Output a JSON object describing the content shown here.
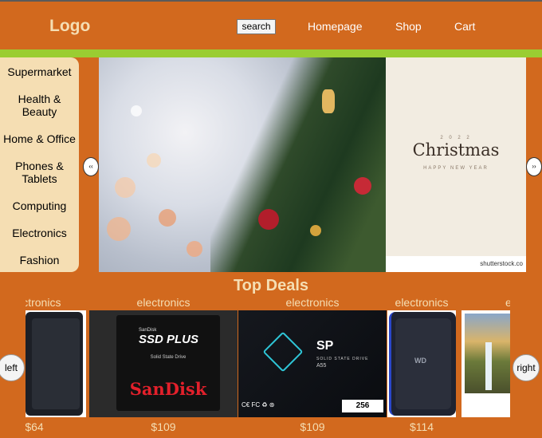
{
  "header": {
    "logo": "Logo",
    "search_label": "search",
    "nav": [
      "Homepage",
      "Shop",
      "Cart"
    ]
  },
  "sidebar": {
    "items": [
      "Supermarket",
      "Health & Beauty",
      "Home & Office",
      "Phones & Tablets",
      "Computing",
      "Electronics",
      "Fashion"
    ]
  },
  "banner": {
    "slide2_title": "Christmas",
    "slide2_top": "2 0 2 2",
    "slide2_sub": "HAPPY NEW YEAR",
    "watermark": "shutterstock.co",
    "prev_label": "‹‹",
    "next_label": "››"
  },
  "deals": {
    "title": "Top Deals",
    "left_label": "left",
    "right_label": "right",
    "products": [
      {
        "category": "electronics",
        "price": "$64",
        "brand": ""
      },
      {
        "category": "electronics",
        "price": "$109",
        "brand": "SanDisk",
        "line1": "SanDisk",
        "line2": "SSD PLUS",
        "line3": "Solid State Drive"
      },
      {
        "category": "electronics",
        "price": "$109",
        "brand": "SP",
        "line1": "SP",
        "line2": "SOLID STATE DRIVE",
        "line3": "A55",
        "capacity": "256"
      },
      {
        "category": "electronics",
        "price": "$114",
        "brand": "WD"
      },
      {
        "category": "e",
        "price": "",
        "brand": ""
      }
    ]
  },
  "colors": {
    "background": "#d2691e",
    "accent_bar": "#9acd32",
    "wheat": "#f5deb3"
  }
}
